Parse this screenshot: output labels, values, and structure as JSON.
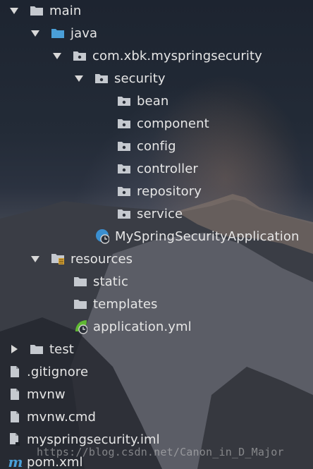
{
  "tree": {
    "items": [
      {
        "label": "main",
        "icon": "folder-icon"
      },
      {
        "label": "java",
        "icon": "source-folder-icon"
      },
      {
        "label": "com.xbk.myspringsecurity",
        "icon": "package-icon"
      },
      {
        "label": "security",
        "icon": "package-icon"
      },
      {
        "label": "bean",
        "icon": "package-icon"
      },
      {
        "label": "component",
        "icon": "package-icon"
      },
      {
        "label": "config",
        "icon": "package-icon"
      },
      {
        "label": "controller",
        "icon": "package-icon"
      },
      {
        "label": "repository",
        "icon": "package-icon"
      },
      {
        "label": "service",
        "icon": "package-icon"
      },
      {
        "label": "MySpringSecurityApplication",
        "icon": "spring-boot-class-icon"
      },
      {
        "label": "resources",
        "icon": "resources-folder-icon"
      },
      {
        "label": "static",
        "icon": "folder-icon"
      },
      {
        "label": "templates",
        "icon": "folder-icon"
      },
      {
        "label": "application.yml",
        "icon": "spring-yml-icon"
      },
      {
        "label": "test",
        "icon": "folder-icon"
      },
      {
        "label": ".gitignore",
        "icon": "file-icon"
      },
      {
        "label": "mvnw",
        "icon": "file-icon"
      },
      {
        "label": "mvnw.cmd",
        "icon": "file-icon"
      },
      {
        "label": "myspringsecurity.iml",
        "icon": "iml-file-icon"
      },
      {
        "label": "pom.xml",
        "icon": "maven-icon"
      }
    ]
  },
  "watermark": "https://blog.csdn.net/Canon_in_D_Major",
  "colors": {
    "text": "#e6e6e6",
    "folder": "#c5c9cf",
    "source_folder": "#4a9fd8",
    "spring": "#5fb832"
  }
}
